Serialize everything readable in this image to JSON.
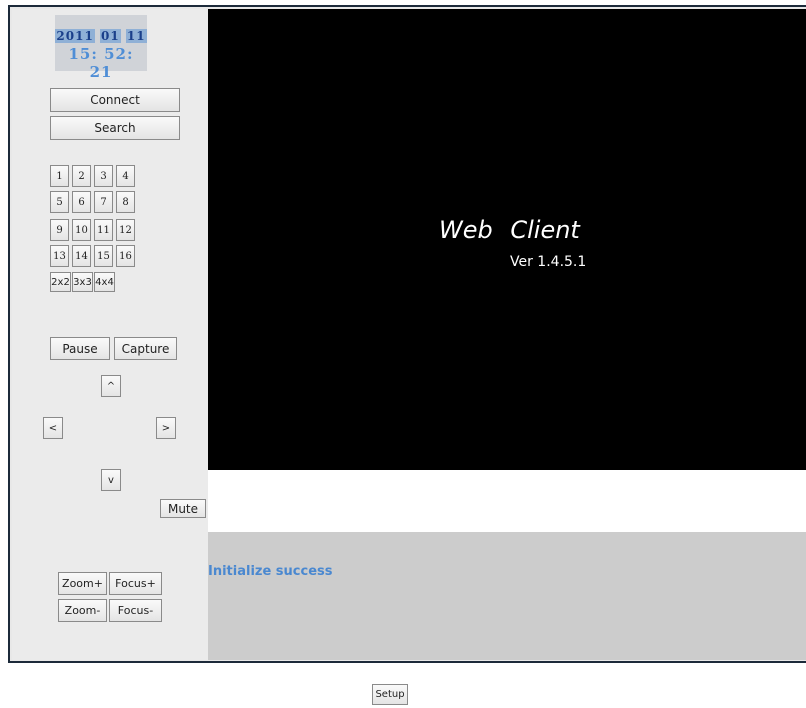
{
  "clock": {
    "year": "2011",
    "month": "01",
    "day": "11",
    "time": "15: 52: 21"
  },
  "buttons": {
    "connect": "Connect",
    "search": "Search",
    "pause": "Pause",
    "capture": "Capture",
    "mute": "Mute",
    "zoom_in": "Zoom+",
    "focus_in": "Focus+",
    "zoom_out": "Zoom-",
    "focus_out": "Focus-",
    "setup": "Setup"
  },
  "channels": [
    "1",
    "2",
    "3",
    "4",
    "5",
    "6",
    "7",
    "8",
    "9",
    "10",
    "11",
    "12",
    "13",
    "14",
    "15",
    "16"
  ],
  "layouts": [
    "2x2",
    "3x3",
    "4x4"
  ],
  "ptz": {
    "up": "^",
    "left": "<",
    "right": ">",
    "down": "v"
  },
  "video": {
    "title": "Web Client",
    "version": "Ver 1.4.5.1"
  },
  "status": {
    "message": "Initialize success"
  }
}
